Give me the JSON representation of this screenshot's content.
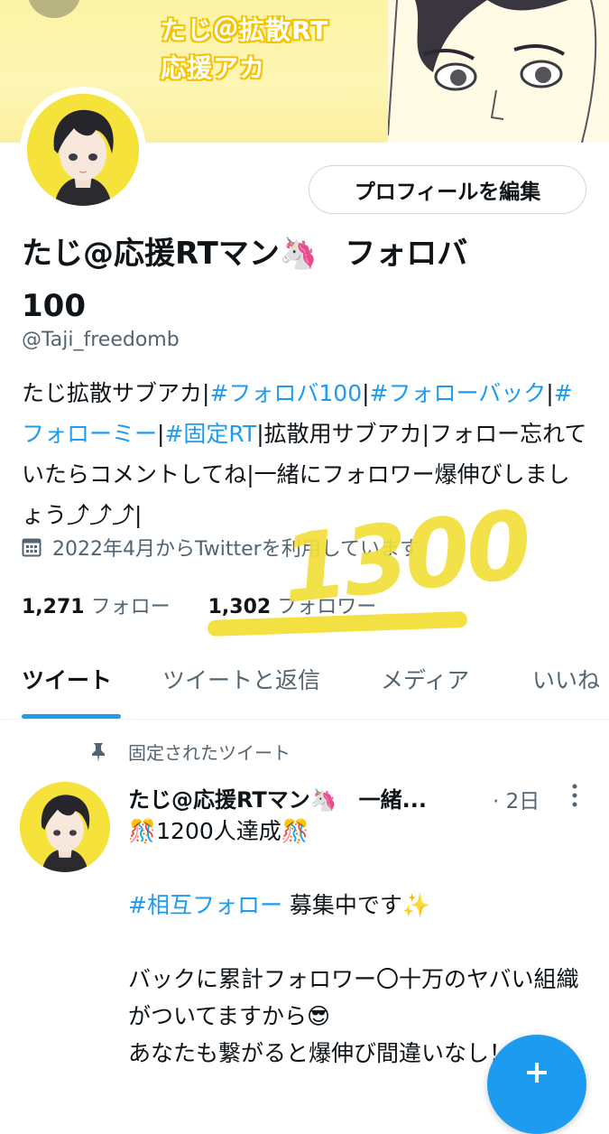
{
  "banner": {
    "line1": "たじ＠拡散RT",
    "line2": "応援アカ"
  },
  "profile": {
    "edit_button": "プロフィールを編集",
    "name_part1": "たじ@応援RTマン",
    "name_emoji": "🦄",
    "name_part2": "フォロバ",
    "name_part3": "100",
    "handle": "@Taji_freedomb",
    "bio": [
      {
        "t": "たじ拡散サブアカ|",
        "tag": false
      },
      {
        "t": "#フォロバ100",
        "tag": true
      },
      {
        "t": "|",
        "tag": false
      },
      {
        "t": "#フォローバック",
        "tag": true
      },
      {
        "t": "|",
        "tag": false
      },
      {
        "t": "#フォローミー",
        "tag": true
      },
      {
        "t": "|",
        "tag": false
      },
      {
        "t": "#固定RT",
        "tag": true
      },
      {
        "t": "|拡散用サブアカ|フォロー忘れていたらコメントしてね|一緒にフォロワー爆伸びしましょう⤴︎⤴︎⤴︎|",
        "tag": false
      }
    ],
    "joined": "2022年4月からTwitterを利用しています",
    "following_count": "1,271",
    "following_label": "フォロー",
    "followers_count": "1,302",
    "followers_label": "フォロワー"
  },
  "overlay": {
    "number": "1300",
    "color": "#f2df3a"
  },
  "tabs": [
    "ツイート",
    "ツイートと返信",
    "メディア",
    "いいね"
  ],
  "pinned_label": "固定されたツイート",
  "tweet": {
    "name": "たじ@応援RTマン🦄　一緒...",
    "time": "· 2日",
    "line1": "🎊1200人達成🎊",
    "hashtag": "#相互フォロー",
    "line2_rest": " 募集中です✨",
    "line3": "バックに累計フォロワー〇十万のヤバい組織がついてますから😎",
    "line4": "あなたも繋がると爆伸び間違いなし！！！"
  },
  "colors": {
    "accent": "#1d9bf0",
    "banner": "#fbf3a4",
    "avatar_bg": "#f5e23b"
  },
  "icons": [
    "calendar-icon",
    "pin-icon",
    "more-vertical-icon",
    "compose-plus-icon"
  ]
}
